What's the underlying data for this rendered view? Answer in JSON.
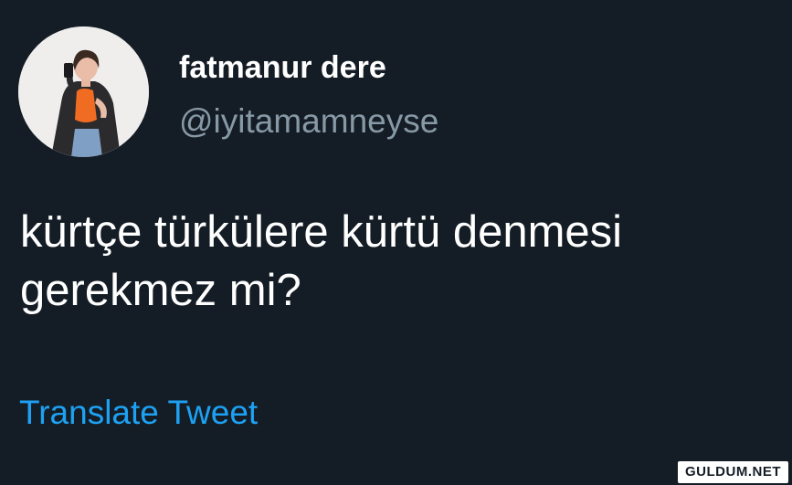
{
  "user": {
    "display_name": "fatmanur dere",
    "handle": "@iyitamamneyse"
  },
  "tweet": {
    "text": "kürtçe türkülere kürtü denmesi gerekmez mi?",
    "translate_label": "Translate Tweet"
  },
  "watermark": "GULDUM.NET",
  "colors": {
    "background": "#141d26",
    "primary_text": "#ffffff",
    "secondary_text": "#8899a6",
    "link": "#1da1f2"
  }
}
